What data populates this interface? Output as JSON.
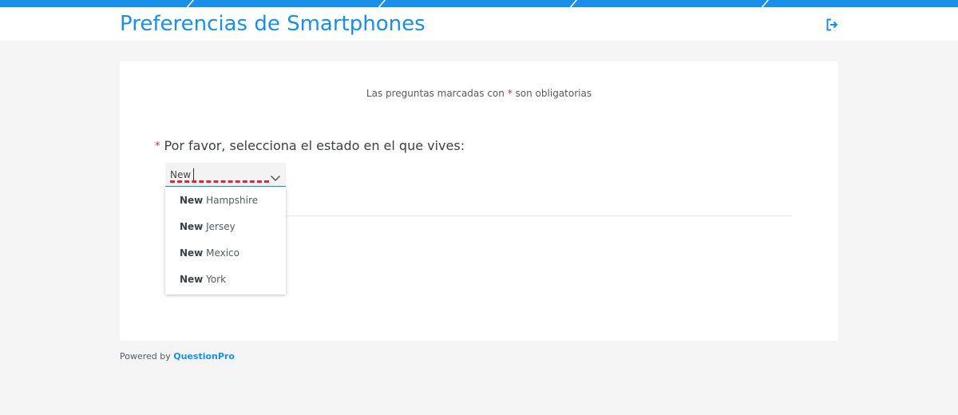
{
  "header": {
    "title": "Preferencias de Smartphones",
    "logout_icon": "logout-icon"
  },
  "survey": {
    "required_note_before": "Las preguntas marcadas con",
    "required_star": "*",
    "required_note_after": "son obligatorias",
    "question_star": "*",
    "question_text": "Por favor, selecciona el estado en el que vives:",
    "input_value": "New",
    "chevron_icon": "chevron-down-icon",
    "options": [
      {
        "match": "New",
        "rest": " Hampshire"
      },
      {
        "match": "New",
        "rest": " Jersey"
      },
      {
        "match": "New",
        "rest": " Mexico"
      },
      {
        "match": "New",
        "rest": " York"
      }
    ]
  },
  "footer": {
    "powered_by": "Powered by",
    "brand": "QuestionPro"
  },
  "colors": {
    "accent": "#1a8fe8",
    "required": "#e0263c",
    "background": "#f5f5f5"
  }
}
